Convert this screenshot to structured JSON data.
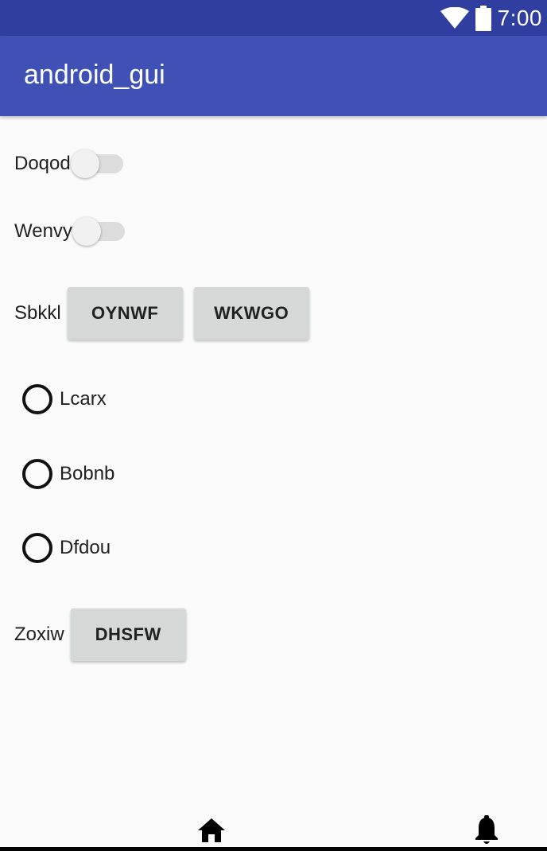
{
  "status_bar": {
    "time": "7:00",
    "icons": [
      "wifi-icon",
      "battery-icon"
    ],
    "color": "#303f9f"
  },
  "app_bar": {
    "title": "android_gui",
    "color": "#3f51b5"
  },
  "switches": [
    {
      "label": "Doqod",
      "checked": false
    },
    {
      "label": "Wenvy",
      "checked": false
    }
  ],
  "button_group_1": {
    "label": "Sbkkl",
    "buttons": [
      "OYNWF",
      "WKWGO"
    ]
  },
  "radios": [
    {
      "label": "Lcarx",
      "checked": false
    },
    {
      "label": "Bobnb",
      "checked": false
    },
    {
      "label": "Dfdou",
      "checked": false
    }
  ],
  "button_group_2": {
    "label": "Zoxiw",
    "buttons": [
      "DHSFW"
    ]
  },
  "bottom_nav": {
    "icons": [
      "home-icon",
      "bell-icon"
    ]
  }
}
